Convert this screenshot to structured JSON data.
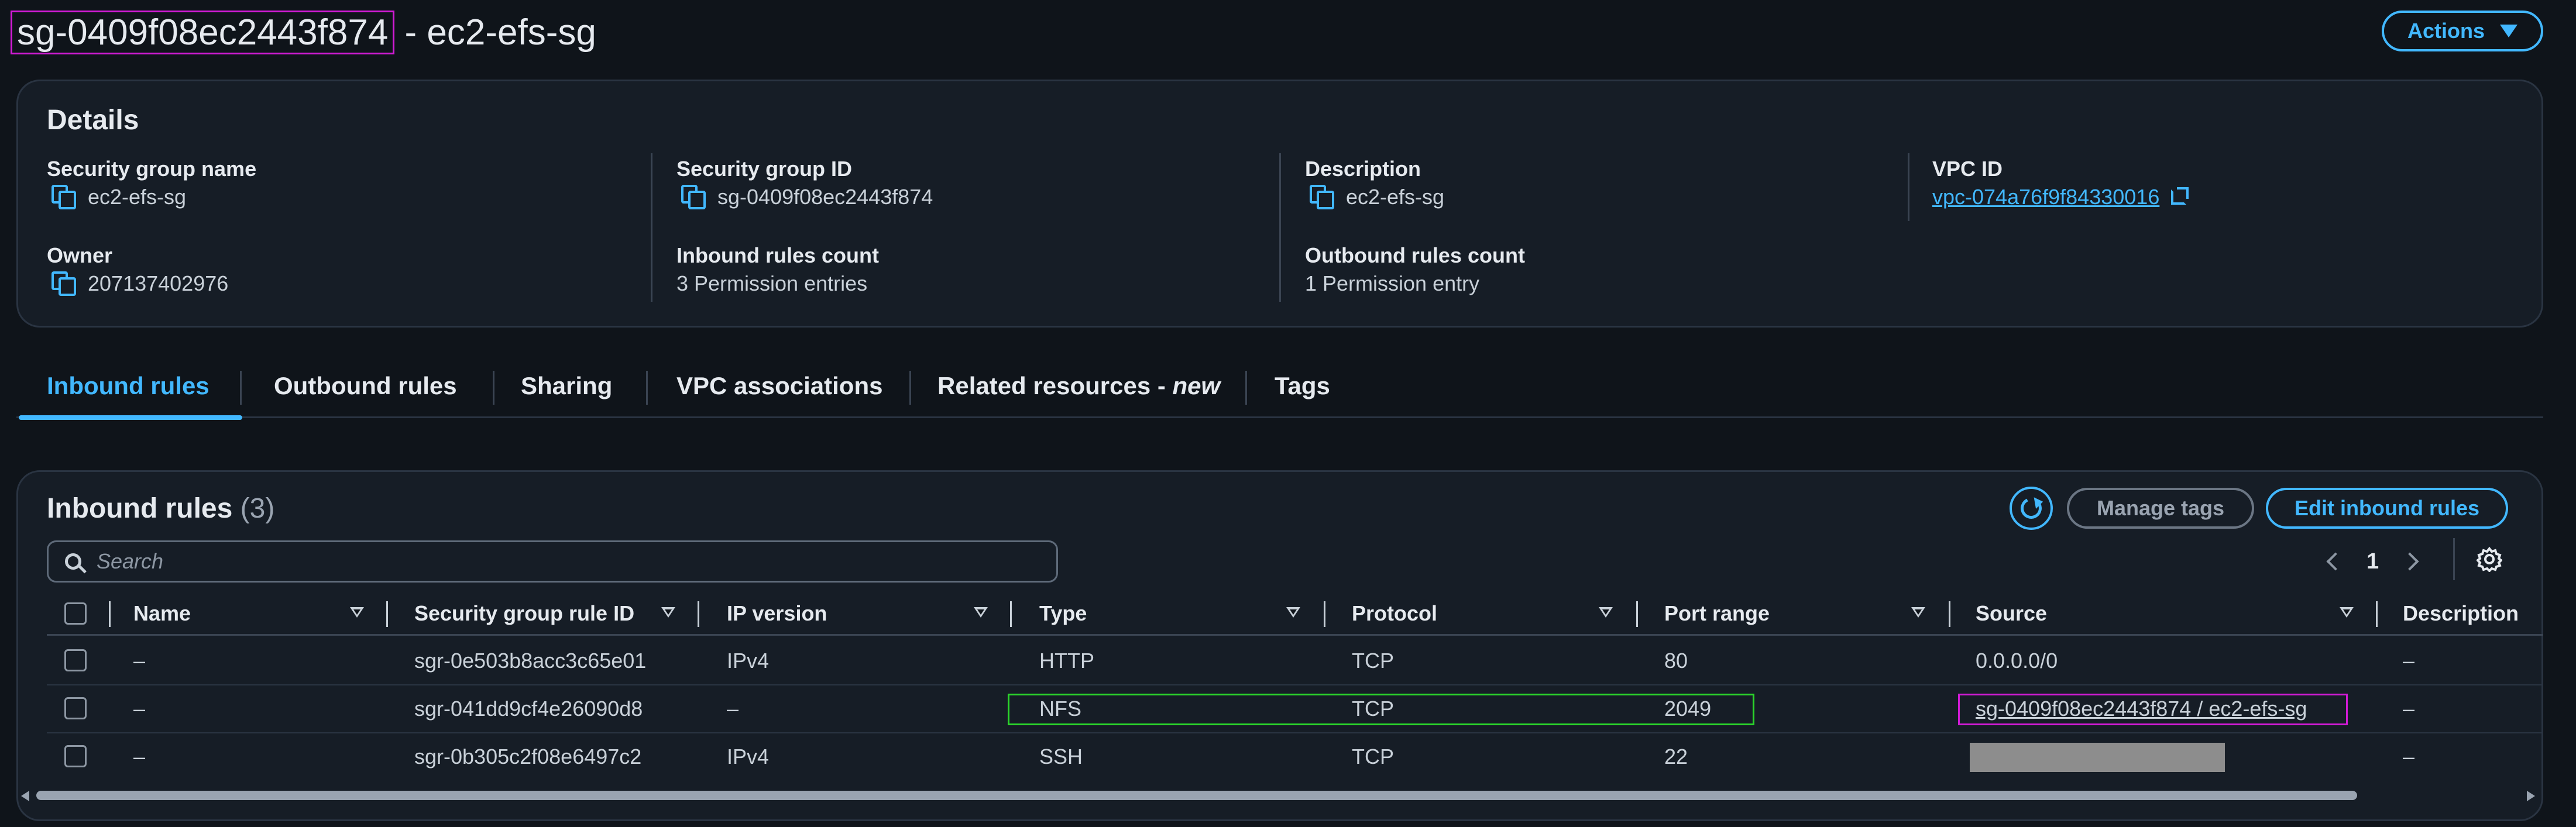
{
  "header": {
    "sg_id": "sg-0409f08ec2443f874",
    "title_suffix": " - ec2-efs-sg",
    "actions_label": "Actions"
  },
  "details": {
    "title": "Details",
    "fields": {
      "sg_name": {
        "label": "Security group name",
        "value": "ec2-efs-sg"
      },
      "sg_id": {
        "label": "Security group ID",
        "value": "sg-0409f08ec2443f874"
      },
      "description": {
        "label": "Description",
        "value": "ec2-efs-sg"
      },
      "vpc_id": {
        "label": "VPC ID",
        "value": "vpc-074a76f9f84330016"
      },
      "owner": {
        "label": "Owner",
        "value": "207137402976"
      },
      "inbound_count": {
        "label": "Inbound rules count",
        "value": "3 Permission entries"
      },
      "outbound_count": {
        "label": "Outbound rules count",
        "value": "1 Permission entry"
      }
    }
  },
  "tabs": [
    {
      "label": "Inbound rules",
      "active": true
    },
    {
      "label": "Outbound rules"
    },
    {
      "label": "Sharing"
    },
    {
      "label": "VPC associations"
    },
    {
      "label": "Related resources - ",
      "suffix_italic": "new"
    },
    {
      "label": "Tags"
    }
  ],
  "rules": {
    "title": "Inbound rules",
    "count": "(3)",
    "manage_tags_label": "Manage tags",
    "edit_label": "Edit inbound rules",
    "search_placeholder": "Search",
    "page": "1",
    "columns": [
      "Name",
      "Security group rule ID",
      "IP version",
      "Type",
      "Protocol",
      "Port range",
      "Source",
      "Description"
    ],
    "rows": [
      {
        "name": "–",
        "rule_id": "sgr-0e503b8acc3c65e01",
        "ip_version": "IPv4",
        "type": "HTTP",
        "protocol": "TCP",
        "port": "80",
        "source": "0.0.0.0/0",
        "description": "–"
      },
      {
        "name": "–",
        "rule_id": "sgr-041dd9cf4e26090d8",
        "ip_version": "–",
        "type": "NFS",
        "protocol": "TCP",
        "port": "2049",
        "source": "sg-0409f08ec2443f874 / ec2-efs-sg",
        "description": "–"
      },
      {
        "name": "–",
        "rule_id": "sgr-0b305c2f08e6497c2",
        "ip_version": "IPv4",
        "type": "SSH",
        "protocol": "TCP",
        "port": "22",
        "source": "",
        "description": "–"
      }
    ]
  },
  "colors": {
    "accent": "#42b8ff",
    "background": "#0f141a",
    "panel": "#161d26",
    "highlight_green": "#2bd52b",
    "highlight_magenta": "#d21bd6"
  }
}
